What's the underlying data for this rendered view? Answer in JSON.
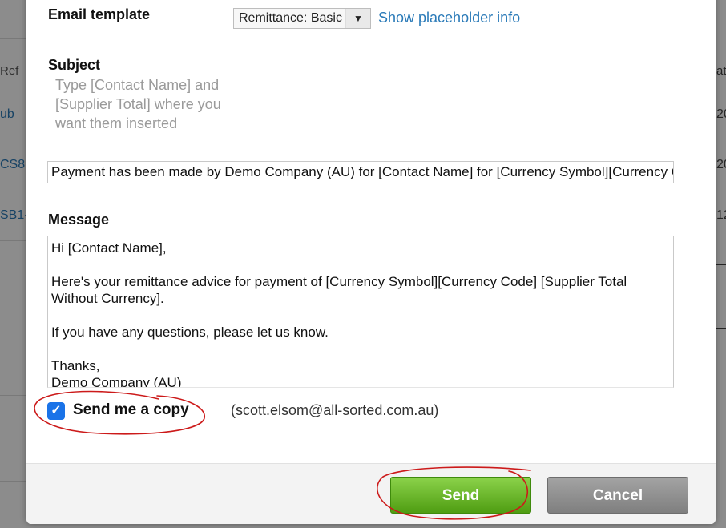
{
  "background": {
    "left_column": {
      "header": "Ref",
      "cells": [
        "ub",
        "CS8",
        "SB1-"
      ]
    },
    "right_column": {
      "header": "at",
      "cells": [
        "20",
        "20",
        "12"
      ]
    }
  },
  "dialog": {
    "email_template": {
      "label": "Email template",
      "selected": "Remittance: Basic",
      "link": "Show placeholder info"
    },
    "subject": {
      "label": "Subject",
      "hint": "Type [Contact Name] and [Supplier Total] where you want them inserted",
      "value": "Payment has been made by Demo Company (AU) for [Contact Name] for [Currency Symbol][Currency Code] [Supplier Total Without Currency]"
    },
    "message": {
      "label": "Message",
      "line1": "Hi [Contact Name],",
      "line2": "Here's your remittance advice for payment of [Currency Symbol][Currency Code] [Supplier Total Without Currency].",
      "line3": "If you have any questions, please let us know.",
      "line4": "Thanks,",
      "line5": "Demo Company (AU)"
    },
    "copy": {
      "checked": true,
      "label": "Send me a copy",
      "email": "(scott.elsom@all-sorted.com.au)"
    },
    "buttons": {
      "send": "Send",
      "cancel": "Cancel"
    }
  },
  "colors": {
    "link": "#2a7ab8",
    "send_button": "#5fae1e",
    "cancel_button": "#8f8f8f",
    "checkbox": "#1a73e8",
    "annotation": "#cc1a1a"
  }
}
